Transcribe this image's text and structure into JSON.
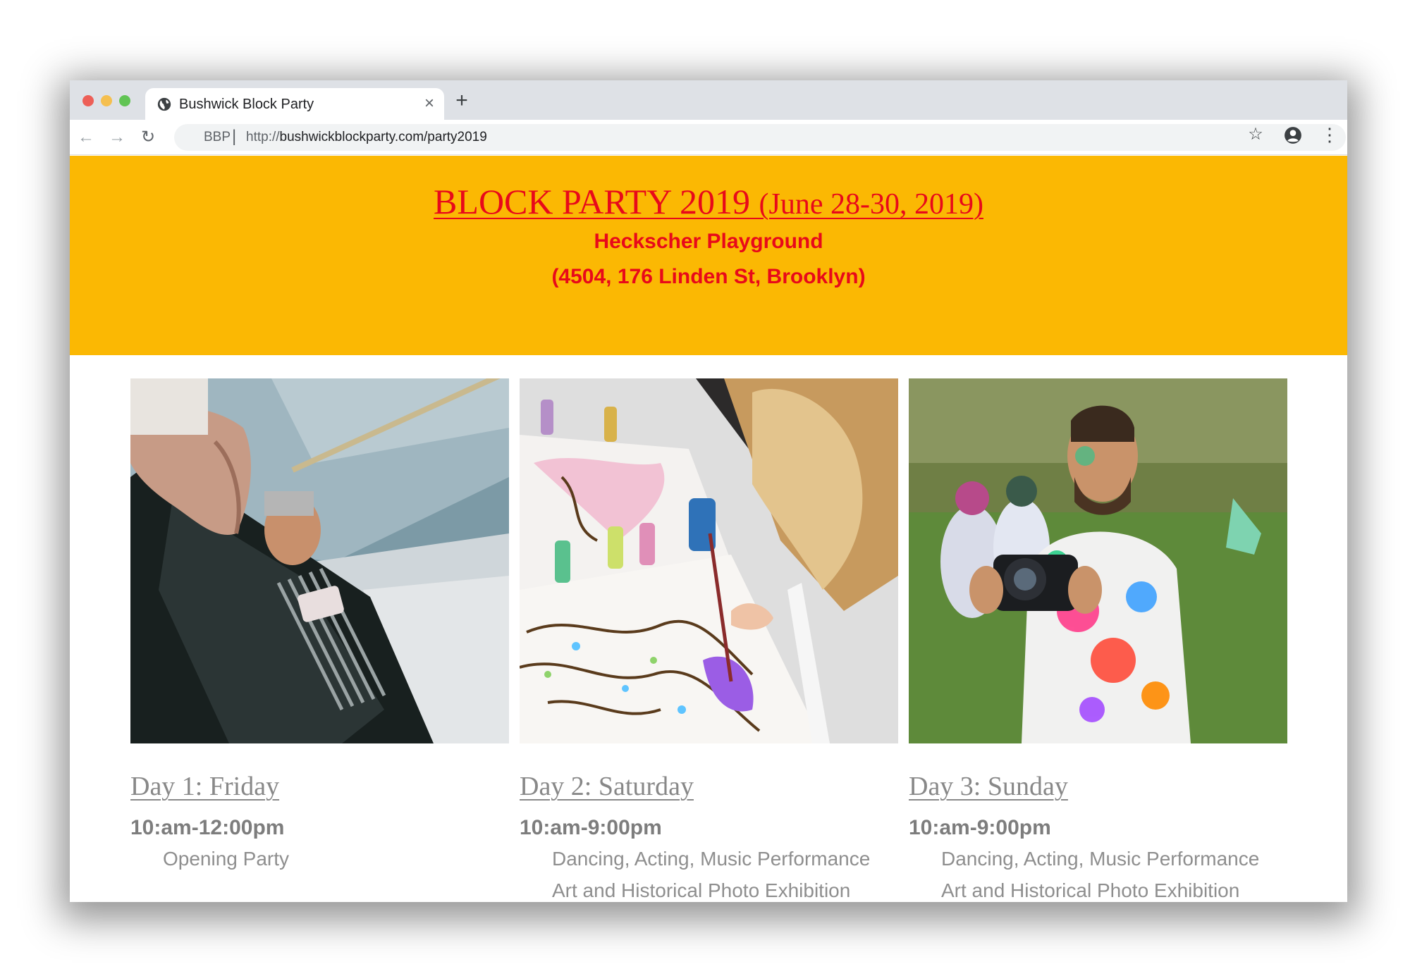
{
  "browser": {
    "tab_title": "Bushwick Block Party",
    "tab_close": "×",
    "new_tab": "+",
    "omnibox_site": "BBP",
    "omnibox_sep": "|",
    "url_protocol": "http://",
    "url_rest": "bushwickblockparty.com/party2019",
    "nav_back": "←",
    "nav_forward": "→",
    "nav_reload": "↻",
    "star": "☆",
    "menu": "⋮"
  },
  "banner": {
    "title_main": "BLOCK PARTY 2019",
    "title_dates": "(June 28-30, 2019)",
    "venue": "Heckscher Playground",
    "address": "(4504, 176 Linden St, Brooklyn)",
    "background_color": "#fbb803",
    "text_color": "#e8091a"
  },
  "days": [
    {
      "title": "Day 1: Friday",
      "time": "10:am-12:00pm",
      "activities": [
        "Opening Party"
      ],
      "photo": "accordion-player-photo"
    },
    {
      "title": "Day 2: Saturday",
      "time": "10:am-9:00pm",
      "activities": [
        "Dancing, Acting, Music Performance",
        "Art and Historical Photo Exhibition"
      ],
      "photo": "painting-photo"
    },
    {
      "title": "Day 3: Sunday",
      "time": "10:am-9:00pm",
      "activities": [
        "Dancing, Acting, Music Performance",
        "Art and Historical Photo Exhibition"
      ],
      "photo": "color-festival-photo"
    }
  ]
}
